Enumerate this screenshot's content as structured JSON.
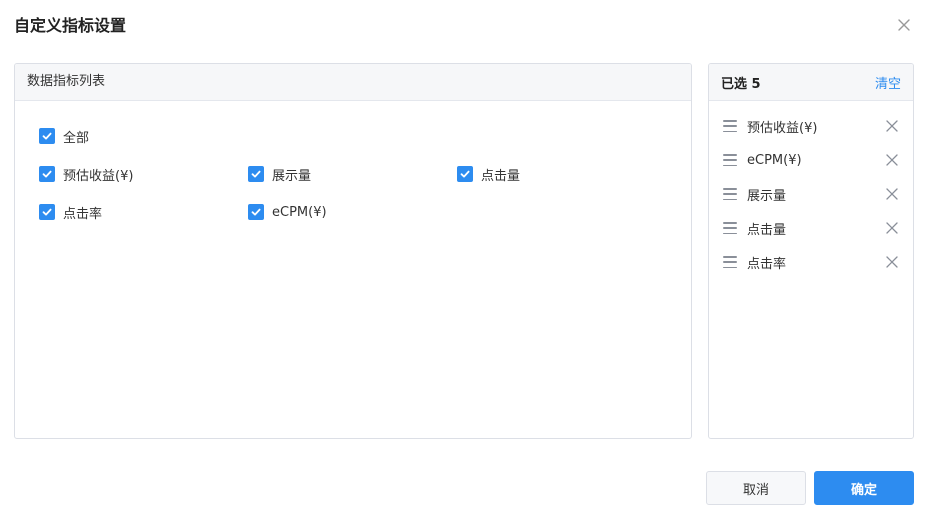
{
  "dialog": {
    "title": "自定义指标设置",
    "close_icon": "close-icon"
  },
  "metric_list": {
    "header": "数据指标列表",
    "select_all": {
      "label": "全部",
      "checked": true
    },
    "items": [
      {
        "label": "预估收益(¥)",
        "checked": true
      },
      {
        "label": "展示量",
        "checked": true
      },
      {
        "label": "点击量",
        "checked": true
      },
      {
        "label": "点击率",
        "checked": true
      },
      {
        "label": "eCPM(¥)",
        "checked": true
      }
    ]
  },
  "selected": {
    "header": "已选 5",
    "clear_label": "清空",
    "items": [
      {
        "label": "预估收益(¥)"
      },
      {
        "label": "eCPM(¥)"
      },
      {
        "label": "展示量"
      },
      {
        "label": "点击量"
      },
      {
        "label": "点击率"
      }
    ]
  },
  "footer": {
    "cancel_label": "取消",
    "ok_label": "确定"
  },
  "colors": {
    "accent": "#2d8cf0",
    "border": "#dcdfe6",
    "header_bg": "#f6f7f9"
  }
}
